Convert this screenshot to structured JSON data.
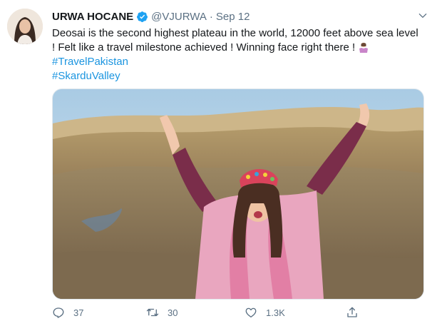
{
  "tweet": {
    "author_name": "URWA HOCANE",
    "handle": "@VJURWA",
    "separator": "·",
    "date": "Sep 12",
    "text_line1": "Deosai is the second highest plateau in the world, 12000 feet above sea level",
    "text_line2": "! Felt like a travel milestone achieved ! Winning face right there  !",
    "hashtags": [
      "#TravelPakistan",
      "#SkarduValley"
    ]
  },
  "actions": {
    "reply_count": "37",
    "retweet_count": "30",
    "like_count": "1.3K"
  },
  "icons": {
    "verified": "verified-badge-icon",
    "caret": "chevron-down-icon",
    "reply": "reply-icon",
    "retweet": "retweet-icon",
    "like": "heart-icon",
    "share": "share-icon"
  },
  "colors": {
    "link": "#1b95e0",
    "muted": "#5b7083",
    "verified": "#1da1f2"
  }
}
